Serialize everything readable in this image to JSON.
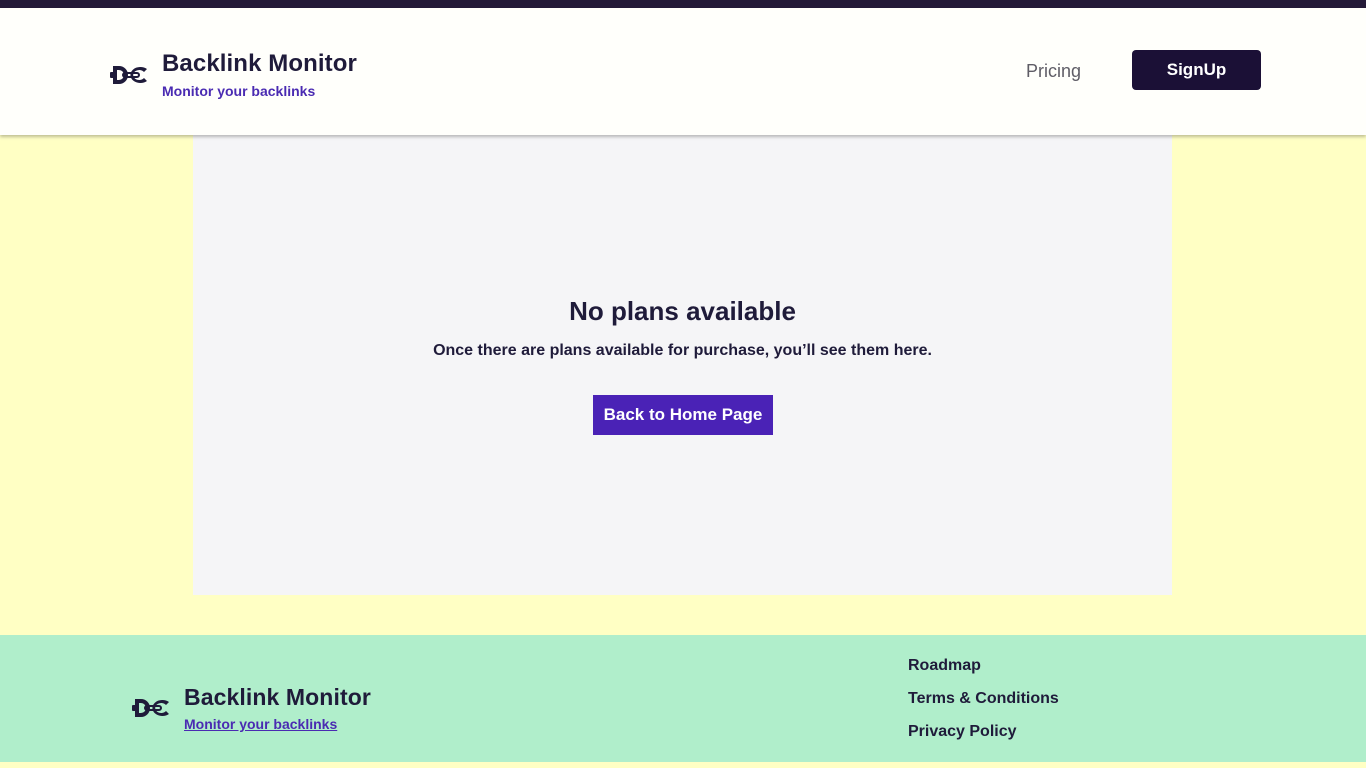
{
  "header": {
    "brand_name": "Backlink Monitor",
    "brand_tagline": "Monitor your backlinks",
    "nav_pricing": "Pricing",
    "signup_label": "SignUp"
  },
  "main": {
    "title": "No plans available",
    "description": "Once there are plans available for purchase, you’ll see them here.",
    "home_button": "Back to Home Page"
  },
  "footer": {
    "brand_name": "Backlink Monitor",
    "brand_tagline": "Monitor your backlinks",
    "links": [
      "Roadmap",
      "Terms & Conditions",
      "Privacy Policy"
    ]
  },
  "colors": {
    "page_background": "#ffffc4",
    "header_background": "#fffffb",
    "top_strip": "#241a38",
    "signup_button": "#1b1036",
    "primary_button": "#4a22b6",
    "tagline": "#4a2bb2",
    "panel_background": "#f5f5f7",
    "footer_background": "#b0eecb"
  },
  "icons": {
    "logo": "chain-link-icon"
  }
}
